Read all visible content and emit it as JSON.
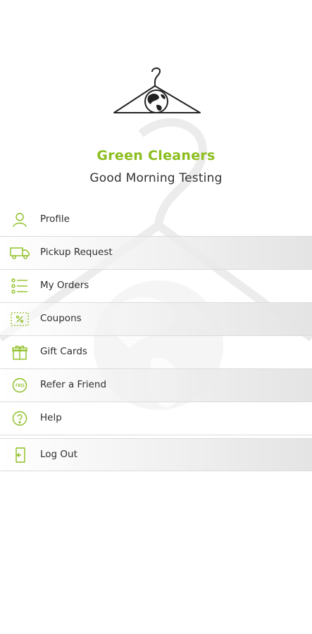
{
  "brand": {
    "name": "Green Cleaners",
    "accent_color": "#8cbe1f"
  },
  "greeting": "Good Morning Testing",
  "menu": {
    "items": [
      {
        "label": "Profile",
        "icon": "user-icon"
      },
      {
        "label": "Pickup Request",
        "icon": "truck-icon"
      },
      {
        "label": "My Orders",
        "icon": "list-icon"
      },
      {
        "label": "Coupons",
        "icon": "coupon-icon"
      },
      {
        "label": "Gift Cards",
        "icon": "gift-icon"
      },
      {
        "label": "Refer a Friend",
        "icon": "free-badge-icon"
      },
      {
        "label": "Help",
        "icon": "help-icon"
      },
      {
        "label": "Log Out",
        "icon": "logout-icon"
      }
    ]
  }
}
